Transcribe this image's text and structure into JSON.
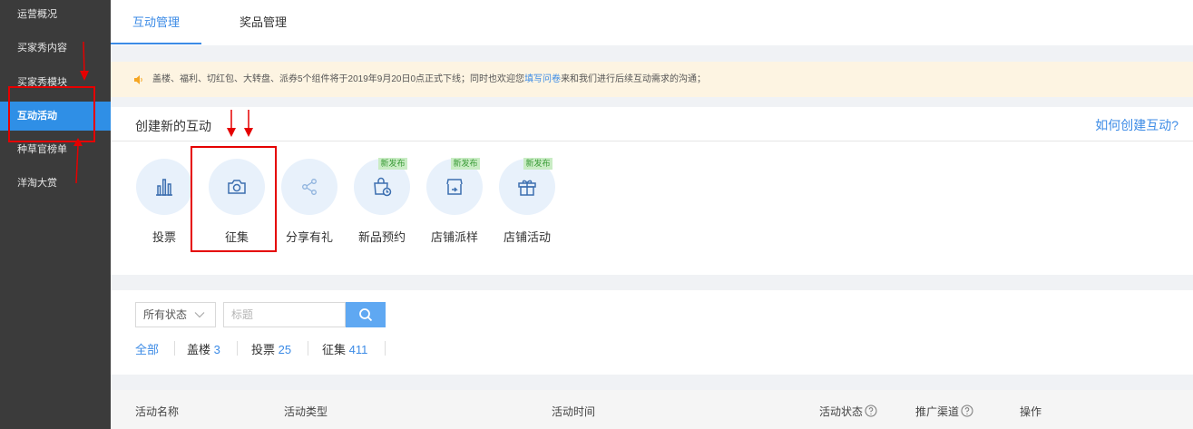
{
  "sidebar": {
    "items": [
      {
        "label": "运营概况"
      },
      {
        "label": "买家秀内容"
      },
      {
        "label": "买家秀模块"
      },
      {
        "label": "互动活动"
      },
      {
        "label": "种草官榜单"
      },
      {
        "label": "洋淘大赏"
      }
    ]
  },
  "tabs": [
    {
      "label": "互动管理"
    },
    {
      "label": "奖品管理"
    }
  ],
  "notice": {
    "text_before": "盖楼、福利、切红包、大转盘、派券5个组件将于2019年9月20日0点正式下线；同时也欢迎您",
    "link": "填写问卷",
    "text_after": "来和我们进行后续互动需求的沟通；"
  },
  "create": {
    "title": "创建新的互动",
    "howto": "如何创建互动?",
    "tiles": [
      {
        "label": "投票",
        "icon": "bar-chart-icon",
        "badge": ""
      },
      {
        "label": "征集",
        "icon": "camera-icon",
        "badge": ""
      },
      {
        "label": "分享有礼",
        "icon": "share-icon",
        "badge": ""
      },
      {
        "label": "新品预约",
        "icon": "shopping-bag-clock-icon",
        "badge": "新发布"
      },
      {
        "label": "店铺派样",
        "icon": "store-share-icon",
        "badge": "新发布"
      },
      {
        "label": "店铺活动",
        "icon": "gift-icon",
        "badge": "新发布"
      }
    ]
  },
  "filter": {
    "status_select": "所有状态",
    "search_placeholder": "标题",
    "tabs": [
      {
        "label": "全部",
        "count": ""
      },
      {
        "label": "盖楼",
        "count": "3"
      },
      {
        "label": "投票",
        "count": "25"
      },
      {
        "label": "征集",
        "count": "411"
      }
    ]
  },
  "table": {
    "headers": [
      "活动名称",
      "活动类型",
      "活动时间",
      "活动状态",
      "推广渠道",
      "操作"
    ]
  },
  "colors": {
    "accent": "#3c8be6",
    "sidebar_bg": "#3b3b3b",
    "annotation_red": "#e50000",
    "badge_green": "#3a9b37"
  }
}
